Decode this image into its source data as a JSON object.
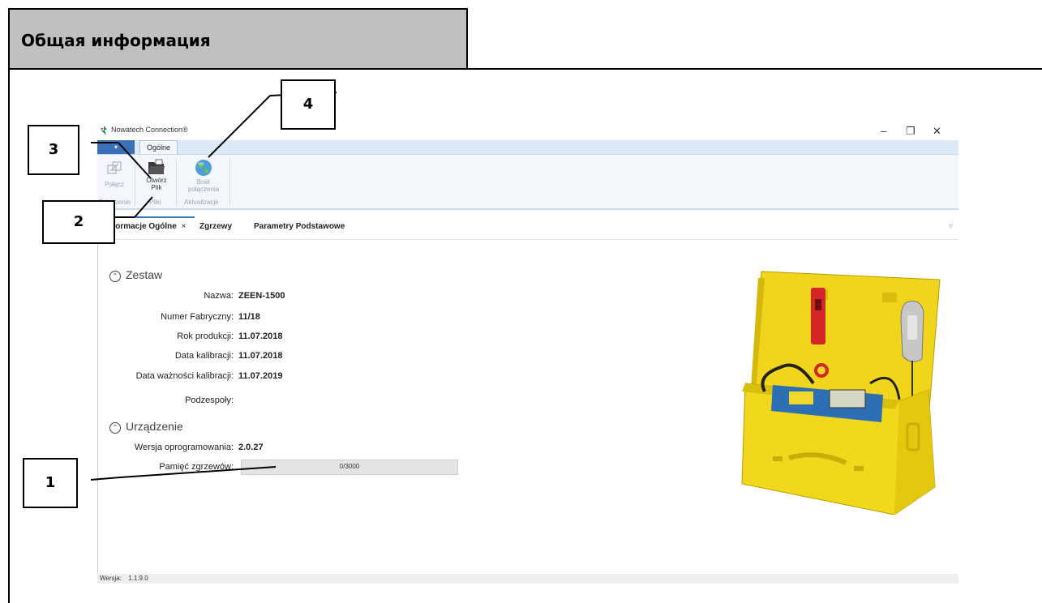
{
  "doc_header": {
    "title": "Общая информация"
  },
  "callouts": [
    "1",
    "2",
    "3",
    "4"
  ],
  "app": {
    "title": "Nowatech Connection®",
    "window_controls": {
      "minimize": "–",
      "restore": "❐",
      "close": "✕"
    },
    "app_menu": "▾",
    "ribbon_tab": "Ogólne",
    "ribbon": {
      "connect": {
        "label": "Połącz",
        "group": "Połączenie"
      },
      "open_file": {
        "label1": "Otwórz",
        "label2": "Plik",
        "group": "Pliki"
      },
      "update": {
        "label1": "Brak",
        "label2": "połączenia",
        "group": "Aktualizacje"
      }
    },
    "doc_tabs": [
      {
        "label": "Informacje Ogólne",
        "close": "×",
        "active": true
      },
      {
        "label": "Zgrzewy"
      },
      {
        "label": "Parametry Podstawowe"
      }
    ],
    "doc_tabs_overflow": "▿",
    "zestaw": {
      "heading": "Zestaw",
      "fields": [
        {
          "label": "Nazwa:",
          "value": "ZEEN-1500"
        },
        {
          "label": "Numer Fabryczny:",
          "value": "11/18"
        },
        {
          "label": "Rok produkcji:",
          "value": "11.07.2018"
        },
        {
          "label": "Data kalibracji:",
          "value": "11.07.2018"
        },
        {
          "label": "Data ważności kalibracji:",
          "value": "11.07.2019"
        },
        {
          "label": "Podzespoły:",
          "value": ""
        }
      ]
    },
    "urzadzenie": {
      "heading": "Urządzenie",
      "fields": [
        {
          "label": "Wersja oprogramowania:",
          "value": "2.0.27"
        },
        {
          "label": "Pamięć zgrzewów:",
          "value": "0/3000",
          "progress": 0
        }
      ]
    },
    "status": {
      "label": "Wersja:",
      "value": "1.1.9.0"
    }
  },
  "colors": {
    "case_yellow": "#f2d81c",
    "ribbon_blue": "#dce9f7",
    "accent": "#3b78c2"
  }
}
